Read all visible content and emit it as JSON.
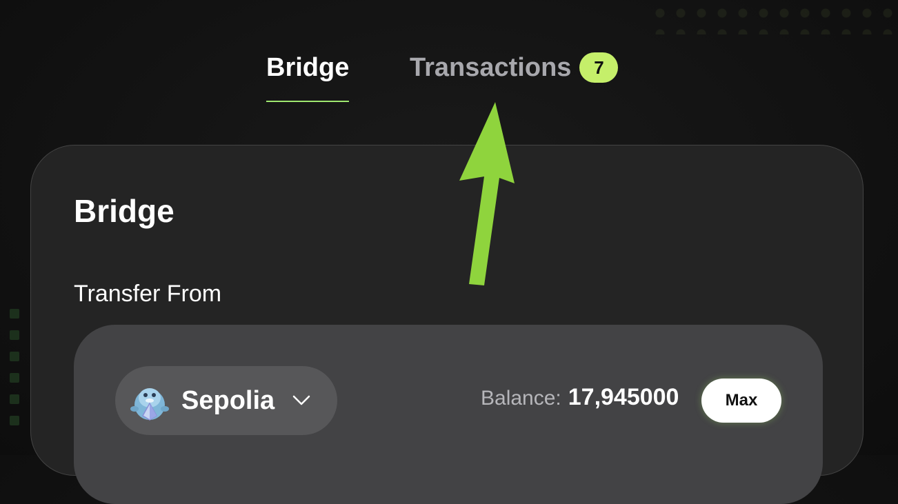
{
  "tabs": {
    "bridge_label": "Bridge",
    "transactions_label": "Transactions",
    "transactions_count": "7"
  },
  "card": {
    "title": "Bridge",
    "transfer_from_label": "Transfer From"
  },
  "source": {
    "chain_name": "Sepolia",
    "chain_icon": "dolphin-mascot-icon",
    "balance_label": "Balance:",
    "balance_value": "17,945000",
    "max_label": "Max"
  },
  "colors": {
    "accent_green": "#9fe870",
    "badge_green": "#c5ef6a",
    "arrow_green": "#8fd43d",
    "card_bg": "#242424",
    "inner_bg": "#434345"
  }
}
